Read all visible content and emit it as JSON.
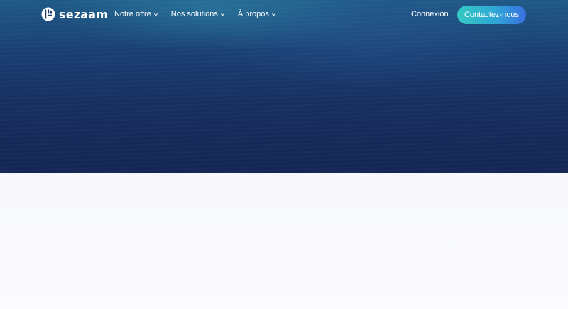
{
  "brand": {
    "name": "sezaam"
  },
  "nav": {
    "items": [
      {
        "label": "Notre offre"
      },
      {
        "label": "Nos solutions"
      },
      {
        "label": "À propos"
      }
    ],
    "login_label": "Connexion",
    "cta_label": "Contactez-nous"
  },
  "colors": {
    "hero_top": "#1f5a86",
    "hero_bottom": "#142654",
    "cta_start": "#35c9c3",
    "cta_end": "#3a6fe0",
    "page_background": "#f7f8fb"
  },
  "icons": {
    "logo": "sezaam-logo-mark",
    "menu_chevron": "chevron-down-icon"
  }
}
